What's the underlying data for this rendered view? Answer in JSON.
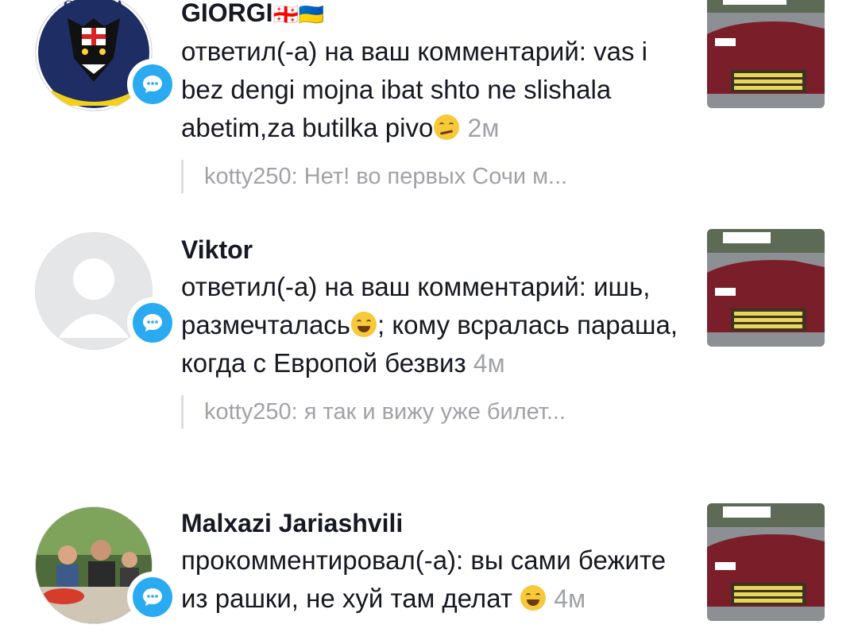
{
  "notifications": [
    {
      "username": "GIORGI",
      "username_flags": "🇬🇪🇺🇦",
      "avatar_text": "GEORGIA",
      "message": "ответил(-а) на ваш комментарий: vas i bez dengi mojna ibat shto ne slishala abetim,za butilka pivo",
      "emoji": "smirk",
      "time": "2м",
      "quote": "kotty250: Нет! во первых Сочи м..."
    },
    {
      "username": "Viktor",
      "message_part1": "ответил(-а) на ваш комментарий: ишь, размечталась",
      "message_part2": "; кому всралась параша, когда с Европой безвиз",
      "emoji": "tears-of-joy",
      "time": "4м",
      "quote": "kotty250: я так и вижу уже билет..."
    },
    {
      "username": "Malxazi Jariashvili",
      "message": "прокомментировал(-а): вы сами бежите из рашки, не хуй там делат",
      "emoji": "tears-of-joy",
      "time": "4м"
    }
  ],
  "colors": {
    "accent_badge": "#2aaaf0",
    "text_primary": "#161823",
    "text_secondary": "#a0a2a8"
  },
  "icons": {
    "badge": "comment-bubble-icon"
  }
}
